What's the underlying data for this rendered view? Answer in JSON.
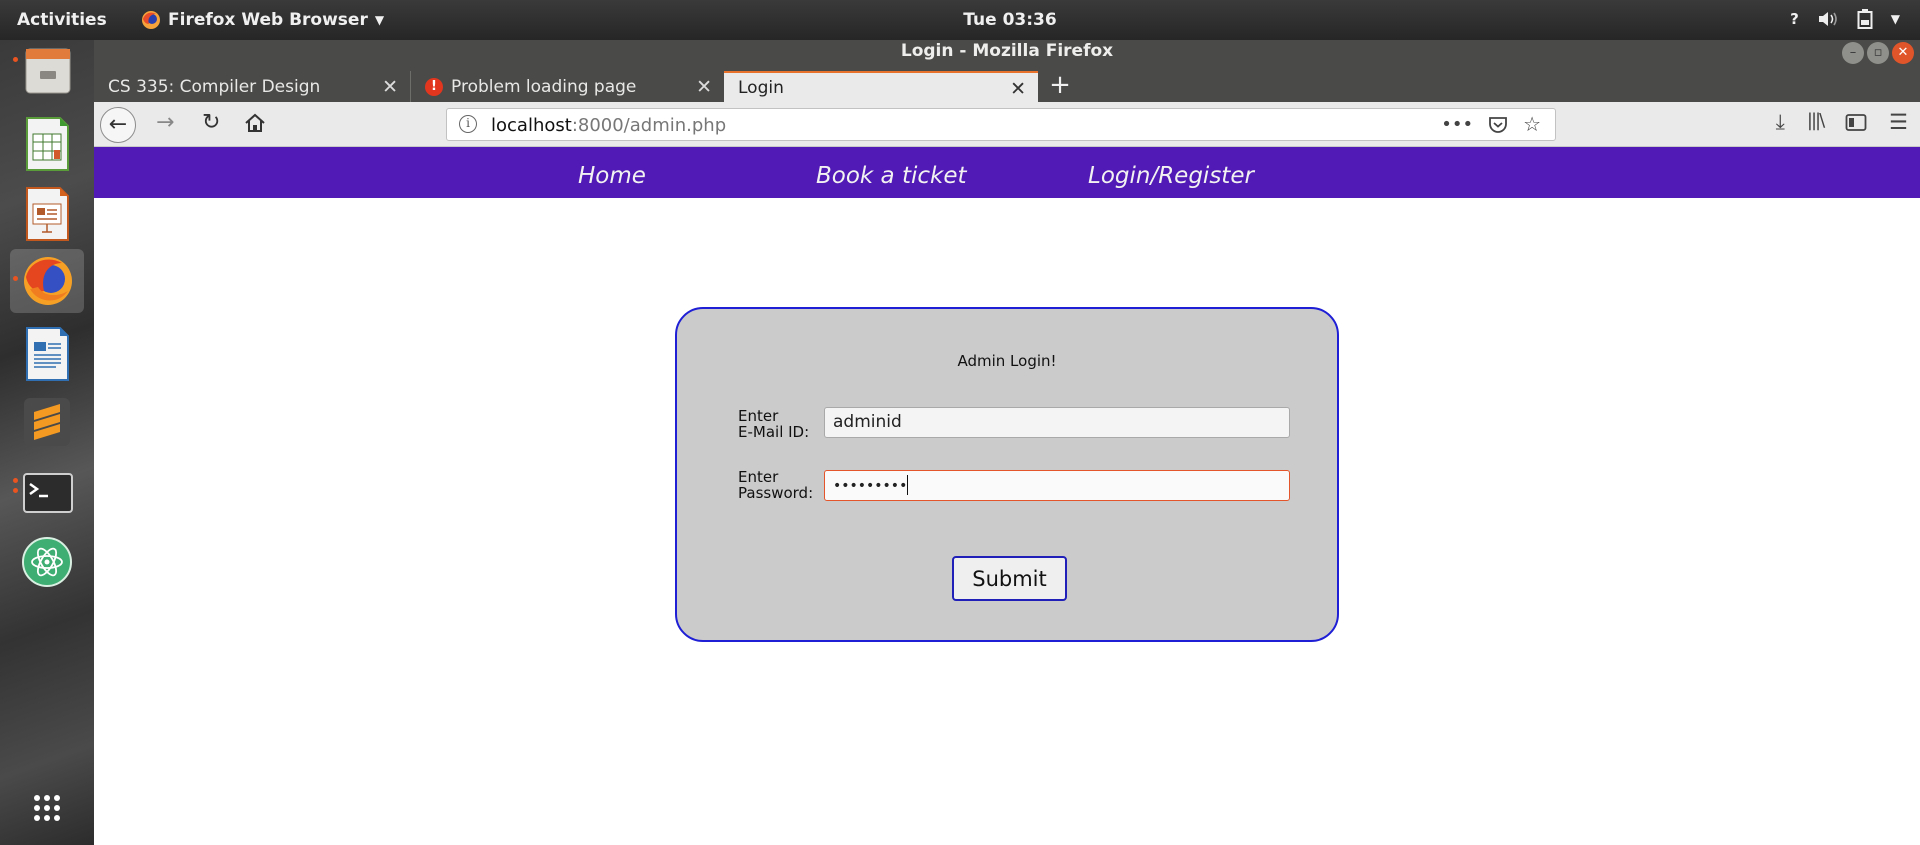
{
  "topbar": {
    "activities": "Activities",
    "app_menu": "Firefox Web Browser",
    "clock": "Tue 03:36"
  },
  "window": {
    "title": "Login - Mozilla Firefox"
  },
  "tabs": [
    {
      "label": "CS 335: Compiler Design",
      "active": false
    },
    {
      "label": "Problem loading page",
      "active": false
    },
    {
      "label": "Login",
      "active": true
    }
  ],
  "toolbar": {
    "url_host": "localhost",
    "url_rest": ":8000/admin.php"
  },
  "site_nav": {
    "items": [
      {
        "label": "Home"
      },
      {
        "label": "Book a ticket"
      },
      {
        "label": "Login/Register"
      }
    ]
  },
  "login_form": {
    "title": "Admin Login!",
    "email_label_line1": "Enter",
    "email_label_line2": "E-Mail ID:",
    "email_value": "adminid",
    "password_label_line1": "Enter",
    "password_label_line2": "Password:",
    "password_mask": "•••••••••",
    "submit_label": "Submit"
  },
  "colors": {
    "site_nav_bg": "#5119b5",
    "login_border": "#1f1fd6",
    "login_bg": "#cbcbcb",
    "ubuntu_accent": "#e95420"
  },
  "dock": {
    "items": [
      {
        "icon": "files-icon"
      },
      {
        "icon": "calc-spreadsheet-icon"
      },
      {
        "icon": "impress-presentation-icon"
      },
      {
        "icon": "firefox-icon"
      },
      {
        "icon": "writer-document-icon"
      },
      {
        "icon": "sublime-text-icon"
      },
      {
        "icon": "terminal-icon"
      },
      {
        "icon": "atom-editor-icon"
      },
      {
        "icon": "show-applications-icon"
      }
    ]
  }
}
